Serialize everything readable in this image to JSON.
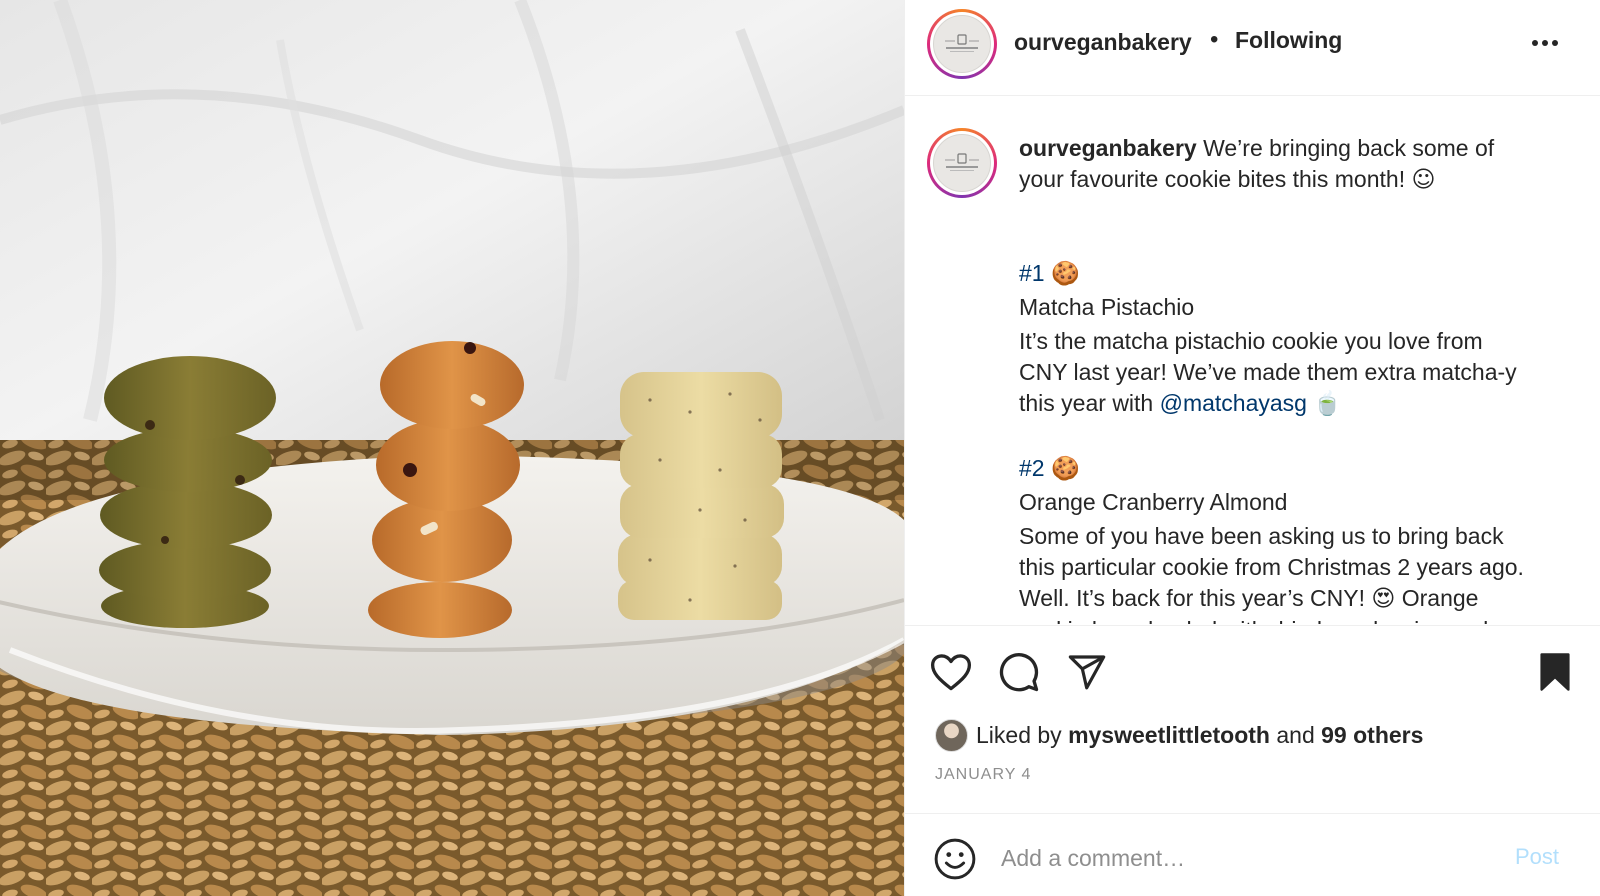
{
  "post": {
    "username": "ourveganbakery",
    "separator": "•",
    "follow_status": "Following",
    "avatar_text": "OUR VEGAN BAKERY",
    "photo_alt": "Three stacks of vegan cookie bites on a white plate"
  },
  "caption": {
    "username": "ourveganbakery",
    "line1": " We’re bringing back some of",
    "line2": "your favourite cookie bites this month! ",
    "line2_emoji": "☺",
    "braille1": "⠀⠀⠀⠀⠀⠀⠀⠀⠀⠀⠀⠀⠀⠀",
    "braille2": "⠀⠀⠀⠀⠀⠀⠀⠀⠀⠀⠀⠀⠀⠀",
    "tag1": "#1",
    "tag1_emoji": "🍪",
    "braille3": "⠀⠀⠀⠀⠀⠀⠀⠀⠀⠀⠀⠀⠀⠀",
    "item1_name": "Matcha Pistachio",
    "braille4": "⠀⠀⠀⠀⠀⠀⠀⠀⠀⠀⠀⠀⠀⠀",
    "item1_line1": "It’s the matcha pistachio cookie you love from",
    "item1_line2": "CNY last year! We’ve made them extra matcha-y",
    "item1_line3_pre": "this year with ",
    "item1_mention": "@matchayasg",
    "item1_emoji": "🍵",
    "braille5": "⠀⠀⠀⠀⠀⠀⠀⠀⠀⠀⠀⠀⠀⠀",
    "braille6": "⠀⠀⠀⠀⠀⠀⠀⠀⠀⠀⠀⠀⠀⠀",
    "tag2": "#2",
    "tag2_emoji": "🍪",
    "braille7": "⠀⠀⠀⠀⠀⠀⠀⠀⠀⠀⠀⠀⠀⠀",
    "item2_name": "Orange Cranberry Almond",
    "braille8": "⠀⠀⠀⠀⠀⠀⠀⠀⠀⠀⠀⠀⠀⠀",
    "item2_line1": "Some of you have been asking us to bring back",
    "item2_line2": "this particular cookie from Christmas 2 years ago.",
    "item2_line3": "Well. It’s back for this year’s CNY! ",
    "item2_emoji": "😍",
    "item2_line3_post": " Orange",
    "item2_line4": "cookie base loaded with dried cranberries and"
  },
  "actions": {
    "like_icon": "heart-outline-icon",
    "comment_icon": "speech-bubble-icon",
    "share_icon": "paper-plane-icon",
    "save_icon": "bookmark-filled-icon",
    "liked_by_prefix": "Liked by ",
    "liked_by_user": "mysweetlittletooth",
    "liked_by_and": " and ",
    "liked_by_others": "99 others",
    "date": "JANUARY 4"
  },
  "comment_bar": {
    "placeholder": "Add a comment…",
    "post_label": "Post",
    "emoji_icon": "smiley-icon"
  },
  "colors": {
    "text": "#262626",
    "secondary": "#8e8e8e",
    "link": "#00376b",
    "post_disabled": "#b2dffc",
    "divider": "#efefef"
  }
}
